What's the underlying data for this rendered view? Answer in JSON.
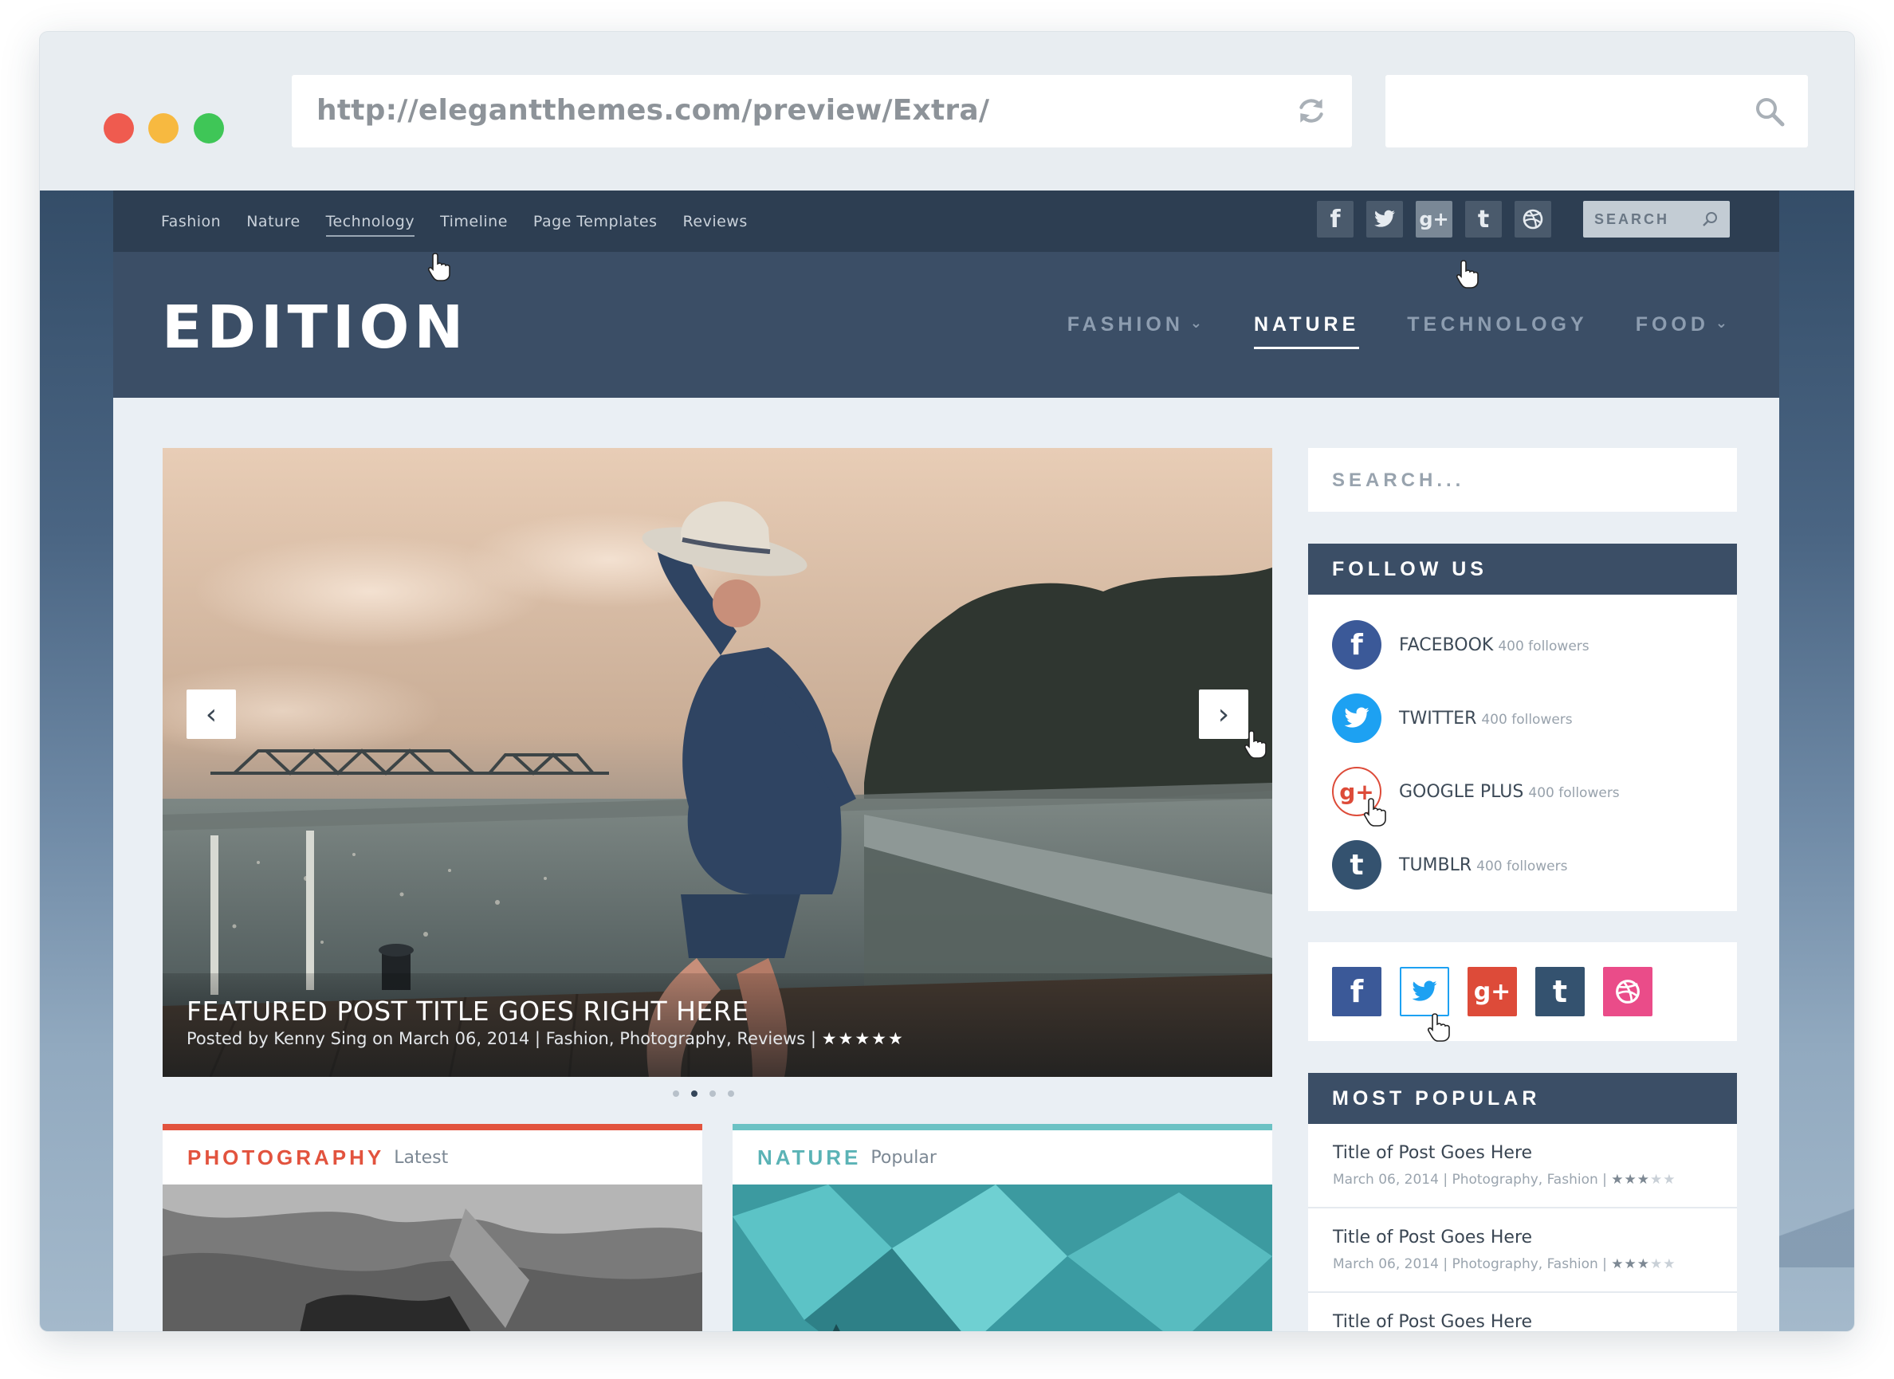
{
  "browser": {
    "url": "http://elegantthemes.com/preview/Extra/",
    "search_value": ""
  },
  "site": {
    "topnav": [
      "Fashion",
      "Nature",
      "Technology",
      "Timeline",
      "Page Templates",
      "Reviews"
    ],
    "top_search_placeholder": "SEARCH",
    "top_social_icons": [
      "facebook-icon",
      "twitter-icon",
      "google-plus-icon",
      "tumblr-icon",
      "dribbble-icon"
    ],
    "logo": "EDITION",
    "mainnav": [
      {
        "label": "FASHION",
        "has_dropdown": true
      },
      {
        "label": "NATURE",
        "active": true
      },
      {
        "label": "TECHNOLOGY"
      },
      {
        "label": "FOOD",
        "has_dropdown": true
      }
    ],
    "dropdown_glyph": "⌄"
  },
  "slider": {
    "title": "FEATURED POST TITLE GOES RIGHT HERE",
    "meta": "Posted by Kenny Sing on March 06, 2014 | Fashion, Photography, Reviews |",
    "stars": "★★★★★",
    "prev_glyph": "‹",
    "next_glyph": "›",
    "slide_count": 4,
    "current_slide": 2
  },
  "categories": [
    {
      "name": "PHOTOGRAPHY",
      "sub": "Latest",
      "color": "#e2533e"
    },
    {
      "name": "NATURE",
      "sub": "Popular",
      "color": "#6cc2c4"
    }
  ],
  "sidebar": {
    "search_placeholder": "SEARCH...",
    "follow_title": "FOLLOW US",
    "follow": [
      {
        "label": "FACEBOOK",
        "count": "400 followers",
        "glyph": "f",
        "color": "#3b5998"
      },
      {
        "label": "TWITTER",
        "count": "400 followers",
        "glyph": "t",
        "color": "#1da1f2"
      },
      {
        "label": "GOOGLE PLUS",
        "count": "400 followers",
        "glyph": "g+",
        "color": "#dd4b39"
      },
      {
        "label": "TUMBLR",
        "count": "400 followers",
        "glyph": "t",
        "color": "#34526f"
      }
    ],
    "popular_title": "MOST POPULAR",
    "popular": [
      {
        "title": "Title of Post Goes Here",
        "meta": "March 06, 2014 | Photography, Fashion |",
        "rating": 3,
        "max": 5
      },
      {
        "title": "Title of Post Goes Here",
        "meta": "March 06, 2014 | Photography, Fashion |",
        "rating": 3,
        "max": 5
      },
      {
        "title": "Title of Post Goes Here",
        "meta": "",
        "rating": 0,
        "max": 5
      }
    ]
  },
  "colors": {
    "header_bg": "#3b4e66",
    "topbar_bg": "#2d3e52",
    "page_bg": "#eaeff4",
    "facebook": "#3b5998",
    "twitter": "#1da1f2",
    "google_plus": "#dd4b39",
    "tumblr": "#34526f",
    "dribbble": "#ea4c89"
  }
}
